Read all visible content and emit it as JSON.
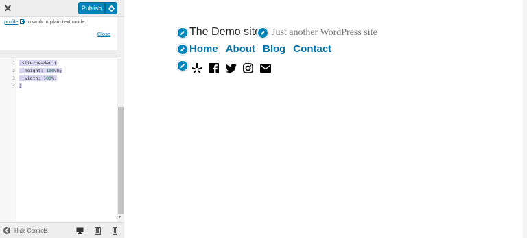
{
  "customizer": {
    "close_label": "✕",
    "publish_label": "Publish",
    "notice": {
      "link_text": "profile",
      "text": "to work in plain text mode.",
      "close_text": "Close"
    },
    "code_lines": [
      {
        "num": "1",
        "text": ".site-header {"
      },
      {
        "num": "2",
        "prop": "height:",
        "val": "100",
        "unit": "vh;"
      },
      {
        "num": "3",
        "prop": "width:",
        "val": "100",
        "unit": "%;"
      },
      {
        "num": "4",
        "text": "}"
      }
    ],
    "footer": {
      "hide_controls": "Hide Controls"
    }
  },
  "preview": {
    "site_title": "The Demo site",
    "tagline": "Just another WordPress site",
    "nav": [
      "Home",
      "About",
      "Blog",
      "Contact"
    ],
    "social_icons": [
      "yelp-icon",
      "facebook-icon",
      "twitter-icon",
      "instagram-icon",
      "email-icon"
    ]
  },
  "colors": {
    "accent": "#0085ba",
    "link": "#0073aa"
  }
}
